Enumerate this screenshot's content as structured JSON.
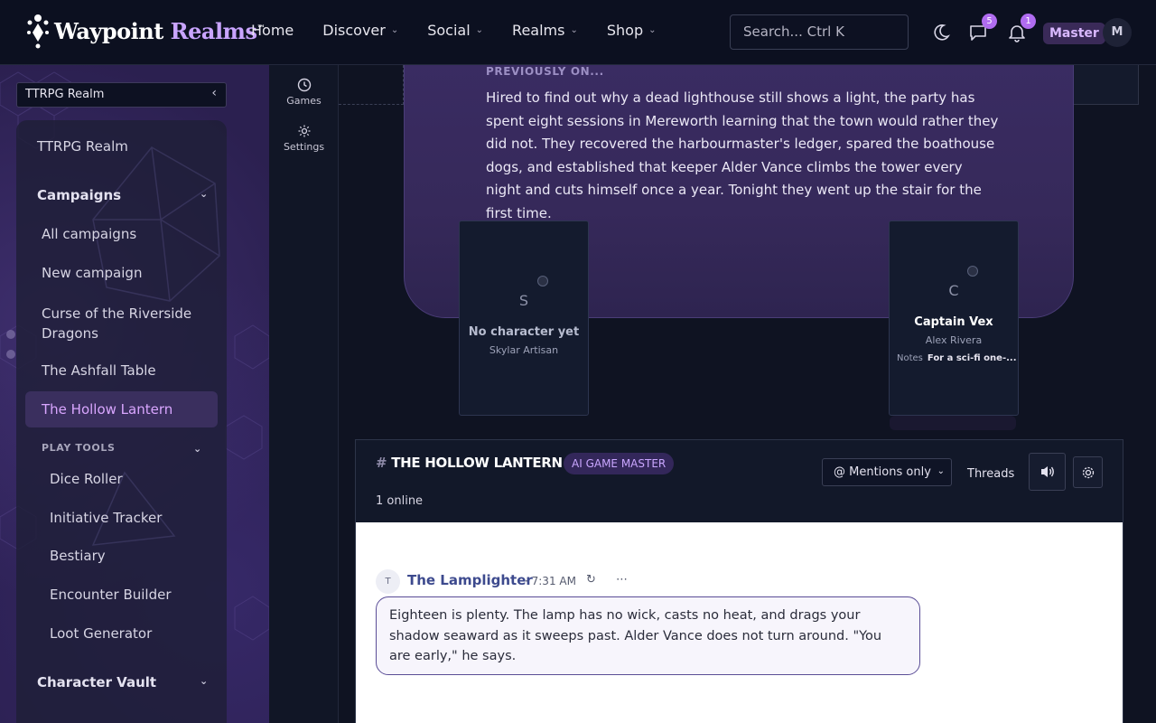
{
  "brand": {
    "name_primary": "Waypoint",
    "name_accent": "Realms",
    "trademark": "™"
  },
  "nav": {
    "items": [
      {
        "label": "Home",
        "has_dropdown": false
      },
      {
        "label": "Discover",
        "has_dropdown": true
      },
      {
        "label": "Social",
        "has_dropdown": true
      },
      {
        "label": "Realms",
        "has_dropdown": true
      },
      {
        "label": "Shop",
        "has_dropdown": true
      }
    ]
  },
  "search": {
    "placeholder": "Search...  Ctrl K"
  },
  "header_icons": {
    "theme_icon": "moon-icon",
    "messages_icon": "chat-icon",
    "messages_count": "5",
    "notifications_icon": "bell-icon",
    "notifications_count": "1"
  },
  "user": {
    "role": "Master",
    "avatar_initial": "M"
  },
  "sidebar": {
    "realm_selector": "TTRPG Realm",
    "realm_home": "TTRPG Realm",
    "campaigns_header": "Campaigns",
    "campaigns": [
      {
        "label": "All campaigns"
      },
      {
        "label": "New campaign"
      },
      {
        "label": "Curse of the Riverside Dragons"
      },
      {
        "label": "The Ashfall Table"
      },
      {
        "label": "The Hollow Lantern",
        "active": true
      }
    ],
    "play_tools_header": "PLAY TOOLS",
    "play_tools": [
      {
        "label": "Dice Roller"
      },
      {
        "label": "Initiative Tracker"
      },
      {
        "label": "Bestiary"
      },
      {
        "label": "Encounter Builder"
      },
      {
        "label": "Loot Generator"
      }
    ],
    "character_vault_header": "Character Vault"
  },
  "rail": {
    "items": [
      {
        "label": "Games",
        "icon": "clock-icon"
      },
      {
        "label": "Settings",
        "icon": "gear-icon"
      }
    ]
  },
  "recap": {
    "label": "PREVIOUSLY ON...",
    "text": "Hired to find out why a dead lighthouse still shows a light, the party has spent eight sessions in Mereworth learning that the town would rather they did not. They recovered the harbourmaster's ledger, spared the boathouse dogs, and established that keeper Alder Vance climbs the tower every night and cuts himself once a year. Tonight they went up the stair for the first time."
  },
  "seats": [
    {
      "initial": "S",
      "character": "No character yet",
      "player": "Skylar Artisan"
    },
    {
      "initial": "C",
      "character": "Captain Vex",
      "player": "Alex Rivera",
      "notes_label": "Notes",
      "notes_value": "For a sci-fi one-..."
    }
  ],
  "channel": {
    "title": "THE HOLLOW LANTERN",
    "hash": "#",
    "badge": "AI GAME MASTER",
    "online": "1 online",
    "filter_value": "@ Mentions only",
    "threads_label": "Threads",
    "sound_icon": "speaker-icon",
    "settings_icon": "gear-icon"
  },
  "messages": [
    {
      "avatar_initial": "T",
      "author": "The Lamplighter",
      "time": "· 7:31 AM",
      "text": "Eighteen is plenty. The lamp has no wick, casts no heat, and drags your shadow seaward as it sweeps past. Alder Vance does not turn around. \"You are early,\" he says."
    }
  ],
  "colors": {
    "accent": "#c9a4ff",
    "badge": "#b06cf0",
    "active_item_bg": "#3a2f5e",
    "active_item_text": "#d9a6ff"
  }
}
